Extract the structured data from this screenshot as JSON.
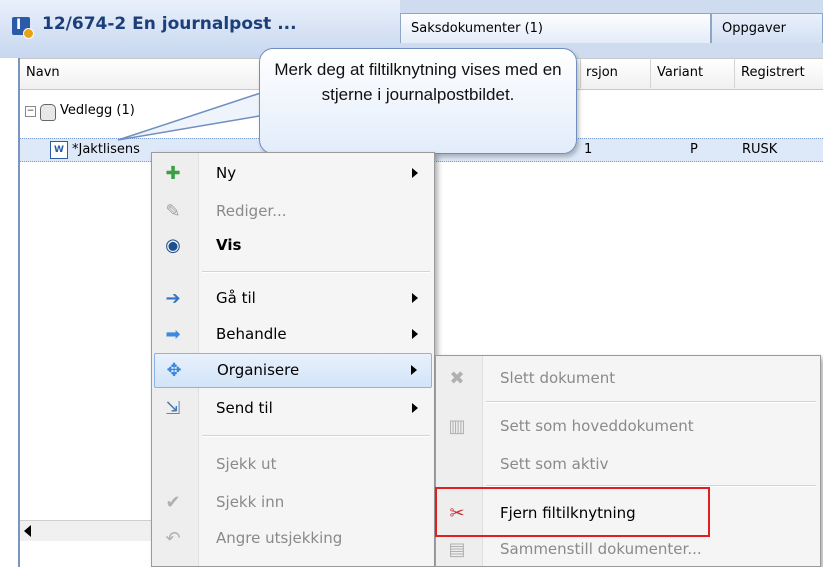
{
  "title_bar": {
    "journal_title": "12/674-2  En journalpost ...",
    "tabs": [
      "Saksdokumenter (1)",
      "Oppgaver"
    ]
  },
  "grid": {
    "columns": [
      "Navn",
      "rsjon",
      "Variant",
      "Registrert"
    ],
    "rows": [
      {
        "name": "Vedlegg (1)"
      },
      {
        "name": "*Jaktlisens",
        "versjon": "1",
        "variant": "P",
        "registrert": "RUSK"
      }
    ]
  },
  "callout": {
    "text": "Merk deg at filtilknytning vises med en stjerne i journalpostbildet."
  },
  "context_menu": [
    {
      "label": "Ny",
      "icon": "plus-icon",
      "submenu": true,
      "enabled": true
    },
    {
      "label": "Rediger...",
      "icon": "pencil-icon",
      "submenu": false,
      "enabled": false
    },
    {
      "label": "Vis",
      "icon": "eye-icon",
      "submenu": false,
      "enabled": true,
      "bold": true
    },
    {
      "label": "Gå til",
      "icon": "goto-arrow-icon",
      "submenu": true,
      "enabled": true
    },
    {
      "label": "Behandle",
      "icon": "process-arrow-icon",
      "submenu": true,
      "enabled": true
    },
    {
      "label": "Organisere",
      "icon": "organize-icon",
      "submenu": true,
      "enabled": true,
      "highlighted": true
    },
    {
      "label": "Send til",
      "icon": "send-icon",
      "submenu": true,
      "enabled": true
    },
    {
      "label": "Sjekk ut",
      "icon": "",
      "submenu": false,
      "enabled": false
    },
    {
      "label": "Sjekk inn",
      "icon": "checkmark-icon",
      "submenu": false,
      "enabled": false
    },
    {
      "label": "Angre utsjekking",
      "icon": "undo-icon",
      "submenu": false,
      "enabled": false
    }
  ],
  "submenu": [
    {
      "label": "Slett dokument",
      "icon": "delete-x-icon",
      "enabled": false
    },
    {
      "label": "Sett som hoveddokument",
      "icon": "main-document-icon",
      "enabled": false
    },
    {
      "label": "Sett som aktiv",
      "icon": "",
      "enabled": false
    },
    {
      "label": "Fjern filtilknytning",
      "icon": "remove-link-icon",
      "enabled": true,
      "emphasized": true
    },
    {
      "label": "Sammenstill dokumenter...",
      "icon": "merge-documents-icon",
      "enabled": false
    }
  ],
  "colors": {
    "highlight_box": "#e02020",
    "title_text": "#1c3f7a"
  }
}
